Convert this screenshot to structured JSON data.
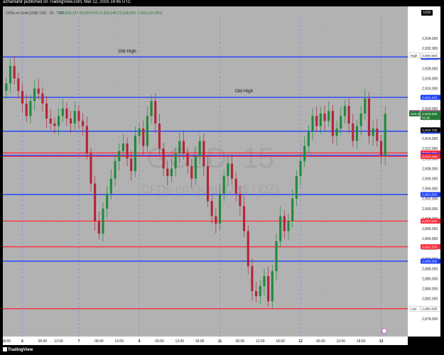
{
  "publisher": "azhantahir published on TradingView.com, Mar 12, 2025 14:45 UTC",
  "header": {
    "symbol": "CFDs on Gold (US$ / OZ) · 15 · TVC",
    "ohlc": "O2,916.137 H2,919.470 L2,916.048 C2,918.925 -2.816 (+0.10%)"
  },
  "currency": "USD",
  "watermark": {
    "symbol": "GOLD, 15",
    "name": "CFDs on Gold (US$ / OZ)"
  },
  "logo_text": "TradingView",
  "colors": {
    "background": "#b2b2b2",
    "support": "#1a3cff",
    "resistance": "#ff2a3c",
    "up": "#1f8a3a",
    "down": "#b3243a",
    "separator": "#3a5aff"
  },
  "chart_data": {
    "type": "candlestick",
    "symbol": "GOLD",
    "timeframe": "15",
    "ylim": [
      2876,
      2936
    ],
    "y_ticks": [
      2878,
      2880,
      2882,
      2884,
      2886,
      2888,
      2890,
      2892,
      2894,
      2896,
      2898,
      2900,
      2902,
      2904,
      2906,
      2908,
      2910,
      2912,
      2914,
      2916,
      2918,
      2920,
      2922,
      2924,
      2926,
      2928,
      2930,
      2932,
      2934
    ],
    "y_tick_labels": [
      "2,878.000",
      "2,880.000",
      "2,882.000",
      "2,884.000",
      "2,886.000",
      "2,888.000",
      "2,890.000",
      "2,892.000",
      "2,894.000",
      "2,896.000",
      "2,898.000",
      "2,900.000",
      "2,902.000",
      "2,904.000",
      "2,906.000",
      "2,908.000",
      "2,910.000",
      "2,912.000",
      "2,914.000",
      "2,916.000",
      "2,918.000",
      "2,920.000",
      "2,922.000",
      "2,924.000",
      "2,926.000",
      "2,928.000",
      "2,930.000",
      "2,932.000",
      "2,934.000"
    ],
    "x_tick_labels": [
      "18:00",
      "6",
      "06:00",
      "12:00",
      "7",
      "06:00",
      "12:00",
      "9",
      "06:00",
      "12:00",
      "18:00",
      "11",
      "06:00",
      "12:00",
      "18:00",
      "12",
      "06:00",
      "12:00",
      "18:00",
      "13"
    ],
    "x_tick_index": [
      0,
      4,
      9,
      13,
      18,
      23,
      28,
      33,
      38,
      43,
      48,
      53,
      58,
      63,
      68,
      73,
      78,
      83,
      88,
      93
    ],
    "horizontal_levels": [
      {
        "price": 2930.299,
        "label": "2,930.299",
        "color": "support"
      },
      {
        "price": 2922.223,
        "label": "2,922.223",
        "color": "support"
      },
      {
        "price": 2915.46,
        "label": "2,915.460",
        "color": "support"
      },
      {
        "price": 2911.118,
        "label": "2,911.118",
        "color": "resistance"
      },
      {
        "price": 2910.632,
        "label": "2,910.632",
        "color": "support"
      },
      {
        "price": 2910.43,
        "label": "2,910.430",
        "color": "resistance"
      },
      {
        "price": 2902.816,
        "label": "2,902.816",
        "color": "support"
      },
      {
        "price": 2897.51,
        "label": "2,897.510",
        "color": "resistance"
      },
      {
        "price": 2892.375,
        "label": "2,892.375",
        "color": "resistance"
      },
      {
        "price": 2889.5,
        "label": "2,889.500",
        "color": "support"
      },
      {
        "price": 2879.995,
        "label": "2,879.995",
        "color": "resistance"
      }
    ],
    "annotations": [
      {
        "text": "Old High",
        "price": 2931.2,
        "bar": 30
      },
      {
        "text": "Old High",
        "price": 2923.2,
        "bar": 59
      }
    ],
    "price_tags": [
      {
        "tag": "High",
        "price": 2930.583,
        "label": "2,930.583"
      },
      {
        "tag": "Ask",
        "price": 2919.15,
        "label": "2,919.150"
      },
      {
        "tag": "Bid",
        "price": 2919.03,
        "label": "2,919.030"
      },
      {
        "tag": "GOLD",
        "price": 2918.925,
        "label": "2,918.925",
        "sub": "01:39"
      },
      {
        "tag": "",
        "price": 2915.72,
        "label": "2,915.720"
      },
      {
        "tag": "Low",
        "price": 2880.0,
        "label": "2,880.000"
      }
    ],
    "closes": [
      2925.0,
      2928.5,
      2926.0,
      2923.5,
      2921.0,
      2918.5,
      2921.5,
      2924.0,
      2923.0,
      2921.0,
      2918.0,
      2917.0,
      2916.5,
      2918.5,
      2920.0,
      2918.0,
      2917.0,
      2919.5,
      2917.5,
      2916.5,
      2911.0,
      2905.0,
      2897.5,
      2895.0,
      2900.0,
      2903.0,
      2906.0,
      2909.5,
      2911.5,
      2913.0,
      2910.0,
      2907.5,
      2914.5,
      2916.0,
      2912.5,
      2918.5,
      2921.5,
      2917.0,
      2912.0,
      2908.0,
      2906.5,
      2908.0,
      2911.0,
      2913.5,
      2911.0,
      2908.5,
      2906.0,
      2910.5,
      2913.5,
      2908.5,
      2901.5,
      2898.5,
      2897.0,
      2903.0,
      2906.5,
      2909.0,
      2906.0,
      2903.0,
      2900.5,
      2895.5,
      2888.5,
      2883.5,
      2882.5,
      2884.5,
      2886.5,
      2881.5,
      2887.5,
      2893.5,
      2898.5,
      2895.5,
      2897.5,
      2902.0,
      2906.5,
      2909.5,
      2912.5,
      2915.5,
      2918.5,
      2916.5,
      2919.0,
      2917.5,
      2919.5,
      2914.5,
      2916.0,
      2918.5,
      2920.5,
      2917.0,
      2913.5,
      2916.5,
      2919.0,
      2922.0,
      2914.5,
      2916.0,
      2913.5,
      2910.5,
      2918.925
    ]
  }
}
